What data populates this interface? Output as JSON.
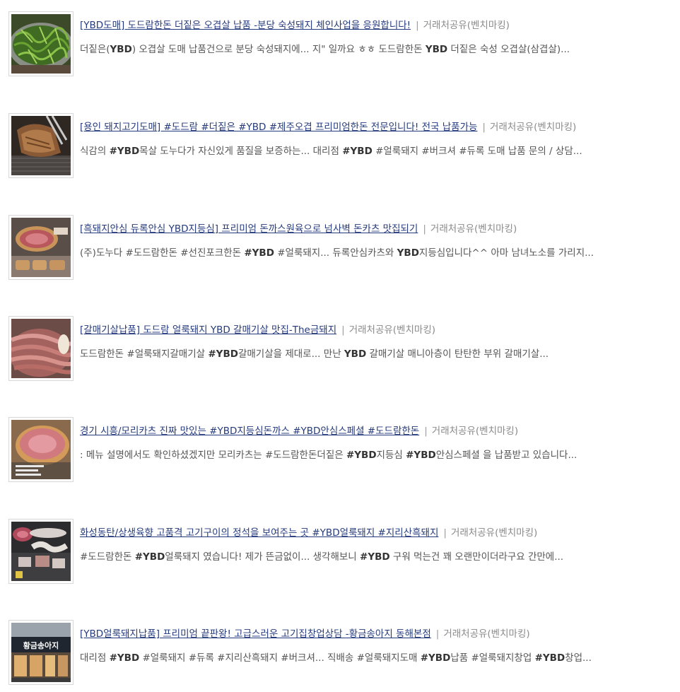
{
  "results": [
    {
      "title": "[YBD도매] 도드람한돈 더짙은 오겹살 납품 -분당 숙성돼지 체인사업을 응원합니다!",
      "source": "거래처공유(벤치마킹)",
      "desc_parts": [
        {
          "t": "더짙은("
        },
        {
          "t": "YBD",
          "b": true
        },
        {
          "t": ") 오겹살 도매 납품건으로 분당 숙성돼지에... 지\" 일까요 ㅎㅎ 도드람한돈 "
        },
        {
          "t": "YBD",
          "b": true
        },
        {
          "t": " 더짙은 숙성 오겹살(삼겹살)..."
        }
      ],
      "thumb": "herbs-on-grill"
    },
    {
      "title": "[용인 돼지고기도매] #도드람 #더짙은 #YBD #제주오겹 프리미엄한돈 전문입니다! 전국 납품가능",
      "source": "거래처공유(벤치마킹)",
      "desc_parts": [
        {
          "t": "식감의 "
        },
        {
          "t": "#YBD",
          "b": true
        },
        {
          "t": "목살 도누다가 자신있게 품질을 보증하는... 대리점 "
        },
        {
          "t": "#YBD",
          "b": true
        },
        {
          "t": " #얼룩돼지 #버크셔 #듀록 도매 납품 문의 / 상담..."
        }
      ],
      "thumb": "grilled-pork-tongs"
    },
    {
      "title": "[흑돼지안심 듀록안심 YBD지등심] 프리미엄 돈까스원육으로 넘사벽 돈카츠 맛집되기",
      "source": "거래처공유(벤치마킹)",
      "desc_parts": [
        {
          "t": "(주)도누다 #도드람한돈 #선진포크한돈 "
        },
        {
          "t": "#YBD",
          "b": true
        },
        {
          "t": " #얼룩돼지... 듀록안심카츠와 "
        },
        {
          "t": "YBD",
          "b": true
        },
        {
          "t": "지등심입니다^^ 아마 남녀노소를 가리지..."
        }
      ],
      "thumb": "tonkatsu-cutlet"
    },
    {
      "title": "[갈매기살납품] 도드람 얼룩돼지 YBD 갈매기살 맛집-The금돼지",
      "source": "거래처공유(벤치마킹)",
      "desc_parts": [
        {
          "t": "도드람한돈 #얼룩돼지갈매기살 "
        },
        {
          "t": "#YBD",
          "b": true
        },
        {
          "t": "갈매기살을 제대로... 만난 "
        },
        {
          "t": "YBD",
          "b": true
        },
        {
          "t": " 갈매기살 매니아층이 탄탄한 부위 갈매기살..."
        }
      ],
      "thumb": "raw-pork-slices"
    },
    {
      "title": "경기 시흥/모리카츠 진짜 맛있는 #YBD지등심돈까스 #YBD안심스페셜 #도드람한돈",
      "source": "거래처공유(벤치마킹)",
      "desc_parts": [
        {
          "t": ": 메뉴 설명에서도 확인하셨겠지만 모리카츠는 #도드람한돈더짙은 "
        },
        {
          "t": "#YBD",
          "b": true
        },
        {
          "t": "지등심 "
        },
        {
          "t": "#YBD",
          "b": true
        },
        {
          "t": "안심스페셜 을 납품받고 있습니다..."
        }
      ],
      "thumb": "pink-cutlet"
    },
    {
      "title": "화성동탄/상생육향 고품격 고기구이의 정석을 보여주는 곳 #YBD얼룩돼지 #지리산흑돼지",
      "source": "거래처공유(벤치마킹)",
      "desc_parts": [
        {
          "t": "#도드람한돈 "
        },
        {
          "t": "#YBD",
          "b": true
        },
        {
          "t": "얼룩돼지 였습니다! 제가 뜬금없이... 생각해보니 "
        },
        {
          "t": "#YBD",
          "b": true
        },
        {
          "t": " 구워 먹는건 꽤 오랜만이더라구요 간만에..."
        }
      ],
      "thumb": "meat-platter"
    },
    {
      "title": "[YBD얼룩돼지납품] 프리미엄 끝판왕! 고급스러운 고기집창업상담 -황금송아지 동해본점",
      "source": "거래처공유(벤치마킹)",
      "desc_parts": [
        {
          "t": "대리점 "
        },
        {
          "t": "#YBD",
          "b": true
        },
        {
          "t": " #얼룩돼지 #듀록 #지리산흑돼지 #버크셔... 직배송 #얼룩돼지도매 "
        },
        {
          "t": "#YBD",
          "b": true
        },
        {
          "t": "납품 #얼룩돼지창업 "
        },
        {
          "t": "#YBD",
          "b": true
        },
        {
          "t": "창업..."
        }
      ],
      "thumb": "storefront",
      "thumb_sign": "황금송아지"
    }
  ]
}
